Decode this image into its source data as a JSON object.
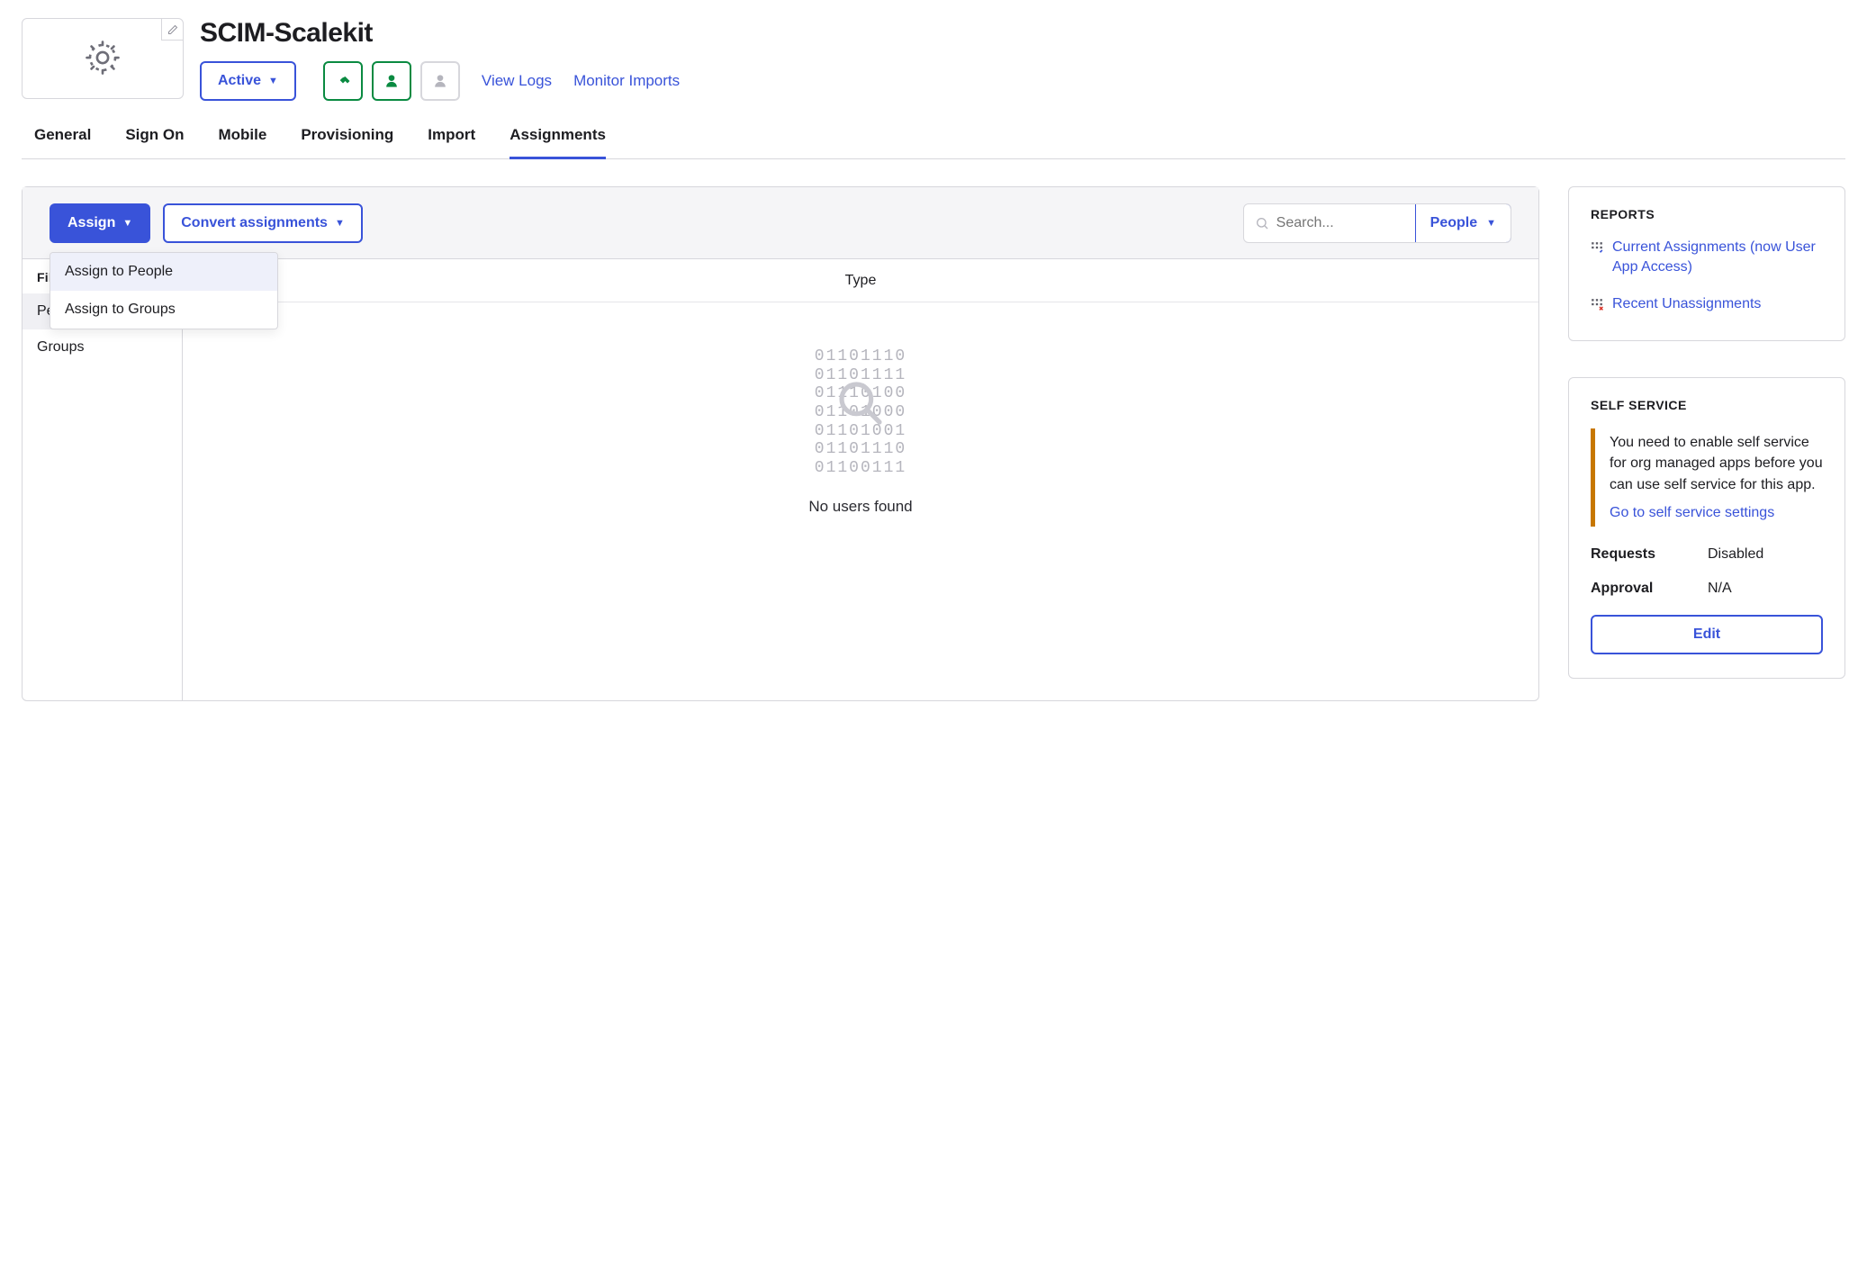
{
  "header": {
    "title": "SCIM-Scalekit",
    "active_label": "Active",
    "view_logs": "View Logs",
    "monitor_imports": "Monitor Imports"
  },
  "tabs": [
    "General",
    "Sign On",
    "Mobile",
    "Provisioning",
    "Import",
    "Assignments"
  ],
  "active_tab_index": 5,
  "toolbar": {
    "assign_label": "Assign",
    "convert_label": "Convert assignments",
    "search_placeholder": "Search...",
    "people_filter_label": "People"
  },
  "assign_menu": {
    "items": [
      "Assign to People",
      "Assign to Groups"
    ],
    "highlighted_index": 0
  },
  "filters": {
    "heading": "Filters",
    "items": [
      "People",
      "Groups"
    ],
    "active_index": 0
  },
  "table": {
    "column_label": "Type",
    "binary_lines": [
      "01101110",
      "01101111",
      "01110100",
      "01101000",
      "01101001",
      "01101110",
      "01100111"
    ],
    "empty_message": "No users found"
  },
  "reports": {
    "heading": "REPORTS",
    "items": [
      "Current Assignments (now User App Access)",
      "Recent Unassignments"
    ]
  },
  "self_service": {
    "heading": "SELF SERVICE",
    "notice": "You need to enable self service for org managed apps before you can use self service for this app.",
    "notice_link": "Go to self service settings",
    "requests_label": "Requests",
    "requests_value": "Disabled",
    "approval_label": "Approval",
    "approval_value": "N/A",
    "edit_label": "Edit"
  }
}
